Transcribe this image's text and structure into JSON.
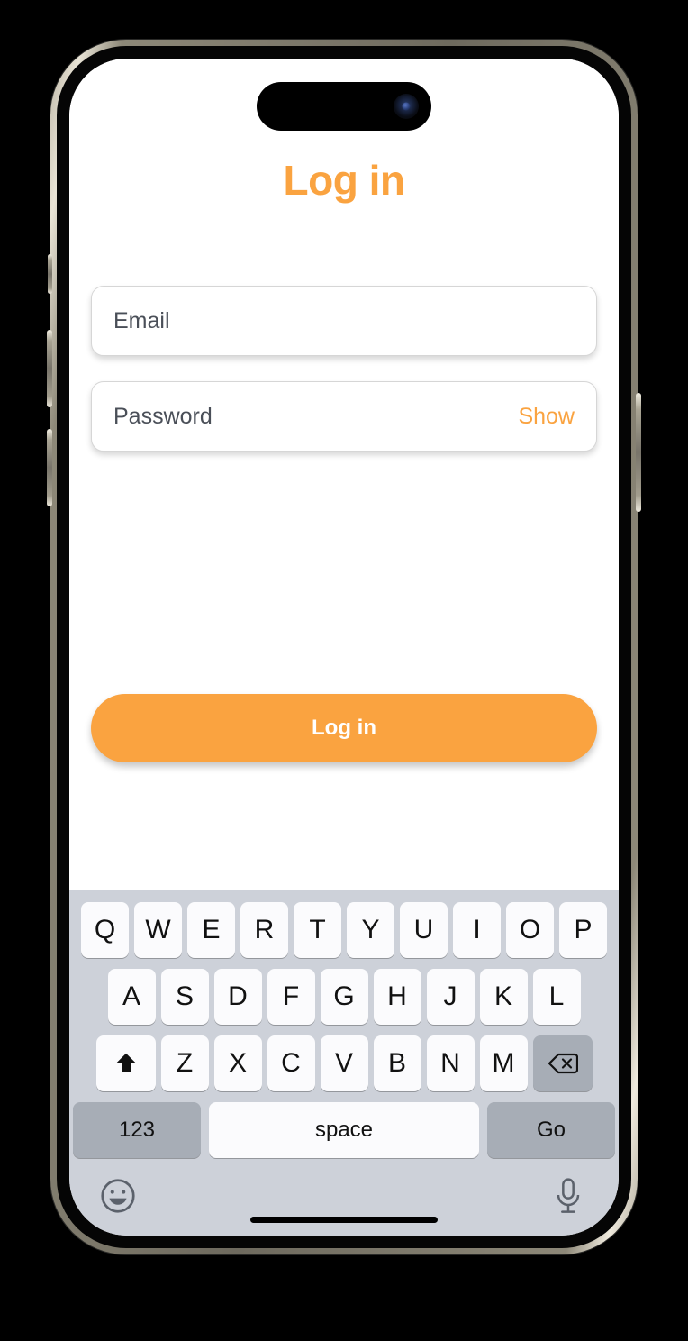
{
  "device": {
    "name": "smartphone-mockup",
    "frame_color": "#8d8878",
    "bezel_color": "#050505",
    "screen_background": "#ffffff"
  },
  "theme": {
    "accent": "#faa340",
    "text": "#4a4f58",
    "keyboard_bg": "#cdd1d9",
    "key_bg": "#fbfbfd",
    "key_gray_bg": "#a7adb6"
  },
  "app": {
    "title": "Log in",
    "fields": [
      {
        "name": "email",
        "placeholder": "Email",
        "value": "",
        "action": ""
      },
      {
        "name": "password",
        "placeholder": "Password",
        "value": "",
        "action": "Show"
      }
    ],
    "submit_label": "Log in"
  },
  "keyboard": {
    "row1": [
      "Q",
      "W",
      "E",
      "R",
      "T",
      "Y",
      "U",
      "I",
      "O",
      "P"
    ],
    "row2": [
      "A",
      "S",
      "D",
      "F",
      "G",
      "H",
      "J",
      "K",
      "L"
    ],
    "row3": [
      "Z",
      "X",
      "C",
      "V",
      "B",
      "N",
      "M"
    ],
    "shift_icon": "shift-icon",
    "backspace_icon": "backspace-icon",
    "numbers_label": "123",
    "space_label": "space",
    "return_label": "Go",
    "emoji_icon": "emoji-icon",
    "mic_icon": "microphone-icon"
  }
}
